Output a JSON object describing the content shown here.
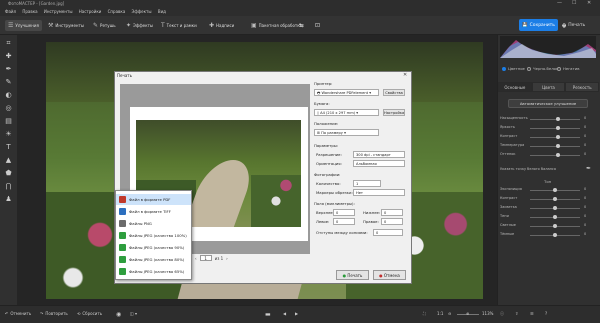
{
  "window": {
    "title": "ФотоМАСТЕР - [Garden.jpg]",
    "controls": [
      "—",
      "☐",
      "✕"
    ]
  },
  "menu": [
    "Файл",
    "Правка",
    "Инструменты",
    "Настройки",
    "Справка",
    "Эффекты",
    "Вид"
  ],
  "toolbar": {
    "tabs": [
      {
        "label": "Улучшения",
        "icon": "sliders-icon"
      },
      {
        "label": "Инструменты",
        "icon": "tools-icon"
      },
      {
        "label": "Ретушь",
        "icon": "brush-icon"
      },
      {
        "label": "Эффекты",
        "icon": "fx-icon"
      },
      {
        "label": "Текст и рамки",
        "icon": "text-icon"
      },
      {
        "label": "Надписи",
        "icon": "caption-icon"
      },
      {
        "label": "Пакетная обработка",
        "icon": "batch-icon"
      }
    ],
    "save_label": "Сохранить",
    "print_label": "Печать"
  },
  "right_panel": {
    "modes": [
      "Цветное",
      "Черно-белое",
      "Негатив"
    ],
    "tabs": [
      "Основные",
      "Цвета",
      "Резкость"
    ],
    "auto_button": "Автоматическое улучшение",
    "sliders": [
      {
        "label": "Насыщенность",
        "value": "0",
        "pos": 0.55
      },
      {
        "label": "Яркость",
        "value": "0",
        "pos": 0.55
      },
      {
        "label": "Контраст",
        "value": "0",
        "pos": 0.55
      },
      {
        "label": "Температура",
        "value": "0",
        "pos": 0.55
      },
      {
        "label": "Оттенок",
        "value": "0",
        "pos": 0.55
      }
    ],
    "white_point": "Указать точку белого баланса",
    "tone_label": "Тон",
    "sliders2": [
      {
        "label": "Экспозиция",
        "value": "0",
        "pos": 0.5
      },
      {
        "label": "Контраст",
        "value": "0",
        "pos": 0.5
      },
      {
        "label": "Засветка",
        "value": "0",
        "pos": 0.5
      },
      {
        "label": "Тени",
        "value": "0",
        "pos": 0.5
      },
      {
        "label": "Светлые",
        "value": "0",
        "pos": 0.5
      },
      {
        "label": "Тёмные",
        "value": "0",
        "pos": 0.5
      }
    ]
  },
  "footer": {
    "undo": "Отменить",
    "redo": "Повторить",
    "reset": "Сбросить",
    "zoom": "1:1",
    "zoom_pct": "113%"
  },
  "dialog": {
    "title": "Печать",
    "close": "✕",
    "printer_label": "Принтер:",
    "printer_value": "Wondershare PDFelement",
    "properties_button": "Свойства",
    "paper_label": "Бумага:",
    "paper_value": "A4 (210 x 297 mm)",
    "setup_button": "Настройка",
    "position_label": "Положение:",
    "position_value": "По размеру",
    "params_label": "Параметры:",
    "resolution_label": "Разрешение:",
    "resolution_value": "300 dpi - стандарт",
    "orientation_label": "Ориентация:",
    "orientation_value": "Альбомная",
    "photos_label": "Фотографии:",
    "count_label": "Количество:",
    "count_value": "1",
    "crop_marks_label": "Маркеры обрезки:",
    "crop_marks_value": "Нет",
    "margins_label": "Поля (миллиметры):",
    "top_label": "Верхнее:",
    "top_value": "0",
    "bottom_label": "Нижнее:",
    "bottom_value": "0",
    "left_label": "Левое:",
    "left_value": "0",
    "right_label": "Правое:",
    "right_value": "0",
    "gap_label": "Отступы между копиями:",
    "gap_value": "0",
    "page_num": "1",
    "page_of": "из 1",
    "print_button": "Печать",
    "cancel_button": "Отмена"
  },
  "dropdown": {
    "items": [
      {
        "label": "Файл в формате PDF",
        "icon": "pdf-icon",
        "color": "#c0392b",
        "selected": true
      },
      {
        "label": "Файл в формате TIFF",
        "icon": "tiff-icon",
        "color": "#2c6fbf",
        "selected": false
      },
      {
        "label": "Файлы PNG",
        "icon": "png-icon",
        "color": "#6b6b6b",
        "selected": false
      },
      {
        "label": "Файлы JPEG (качество 100%)",
        "icon": "jpeg-icon",
        "color": "#2e9e3e",
        "selected": false
      },
      {
        "label": "Файлы JPEG (качество 90%)",
        "icon": "jpeg-icon",
        "color": "#2e9e3e",
        "selected": false
      },
      {
        "label": "Файлы JPEG (качество 80%)",
        "icon": "jpeg-icon",
        "color": "#2e9e3e",
        "selected": false
      },
      {
        "label": "Файлы JPEG (качество 65%)",
        "icon": "jpeg-icon",
        "color": "#2e9e3e",
        "selected": false
      }
    ]
  }
}
